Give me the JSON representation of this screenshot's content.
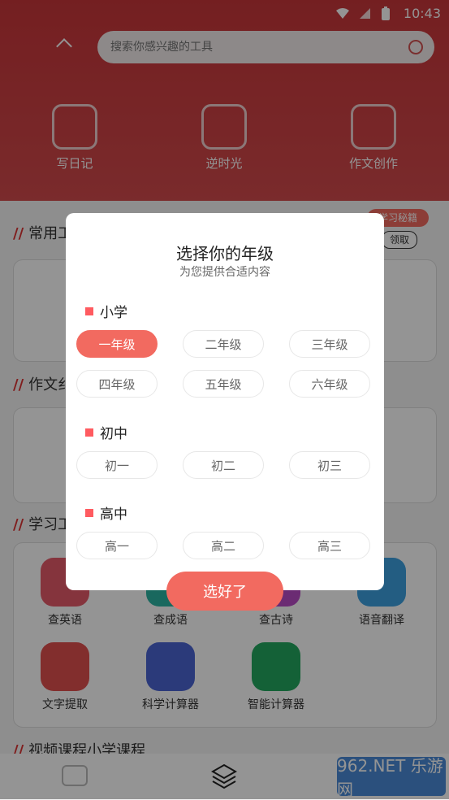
{
  "status": {
    "time": "10:43"
  },
  "search": {
    "placeholder": "搜索你感兴趣的工具"
  },
  "top_tools": [
    "写日记",
    "逆时光",
    "作文创作"
  ],
  "sections": {
    "common": "常用工",
    "composition": "作文纟",
    "study": "学习工",
    "video": "视频课程小学课程"
  },
  "badge": {
    "text": "学习秘籍",
    "small": "领取"
  },
  "study_tools_row1": [
    "查英语",
    "查成语",
    "查古诗",
    "语音翻译"
  ],
  "study_tools_row2": [
    "文字提取",
    "科学计算器",
    "智能计算器"
  ],
  "dialog": {
    "title": "选择你的年级",
    "subtitle": "为您提供合适内容",
    "groups": [
      {
        "label": "小学",
        "options": [
          "一年级",
          "二年级",
          "三年级",
          "四年级",
          "五年级",
          "六年级"
        ]
      },
      {
        "label": "初中",
        "options": [
          "初一",
          "初二",
          "初三"
        ]
      },
      {
        "label": "高中",
        "options": [
          "高一",
          "高二",
          "高三"
        ]
      }
    ],
    "selected": "一年级",
    "confirm": "选好了"
  },
  "watermark": "962.NET 乐游网",
  "colors": {
    "accent": "#f26a60",
    "header": "#c9363a"
  }
}
